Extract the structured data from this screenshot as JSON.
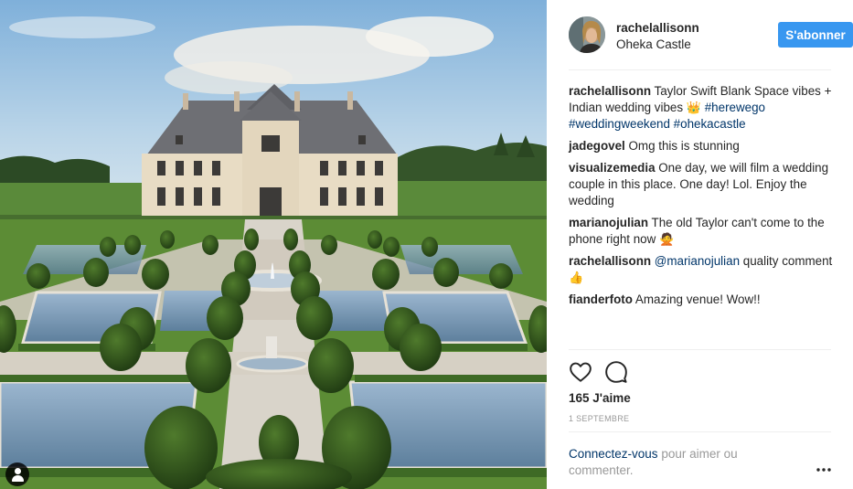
{
  "post": {
    "image_icon": "user-tag-icon",
    "author": {
      "username": "rachelallisonn",
      "location": "Oheka Castle",
      "avatar_icon": "profile-photo"
    },
    "follow_label": "S'abonner",
    "colors": {
      "accent": "#3897f0",
      "link": "#003569",
      "muted": "#999999",
      "text": "#262626"
    }
  },
  "comments": [
    {
      "username": "rachelallisonn",
      "text": "Taylor Swift Blank Space vibes + Indian wedding vibes",
      "emoji": "👑",
      "hashtags": [
        "#herewego",
        "#weddingweekend",
        "#ohekacastle"
      ]
    },
    {
      "username": "jadegovel",
      "text": "Omg this is stunning"
    },
    {
      "username": "visualizemedia",
      "text": "One day, we will film a wedding couple in this place. One day! Lol. Enjoy the wedding"
    },
    {
      "username": "marianojulian",
      "text": "The old Taylor can't come to the phone right now",
      "emoji": "🙅"
    },
    {
      "username": "rachelallisonn",
      "mention": "@marianojulian",
      "text": "quality comment",
      "emoji": "👍"
    },
    {
      "username": "fianderfoto",
      "text": "Amazing venue! Wow!!"
    }
  ],
  "actions": {
    "like_icon": "heart-icon",
    "comment_icon": "comment-bubble-icon",
    "more_icon": "more-options-icon"
  },
  "likes": "165 J'aime",
  "date": "1 septembre",
  "login": {
    "link": "Connectez-vous",
    "rest": " pour aimer ou commenter."
  }
}
